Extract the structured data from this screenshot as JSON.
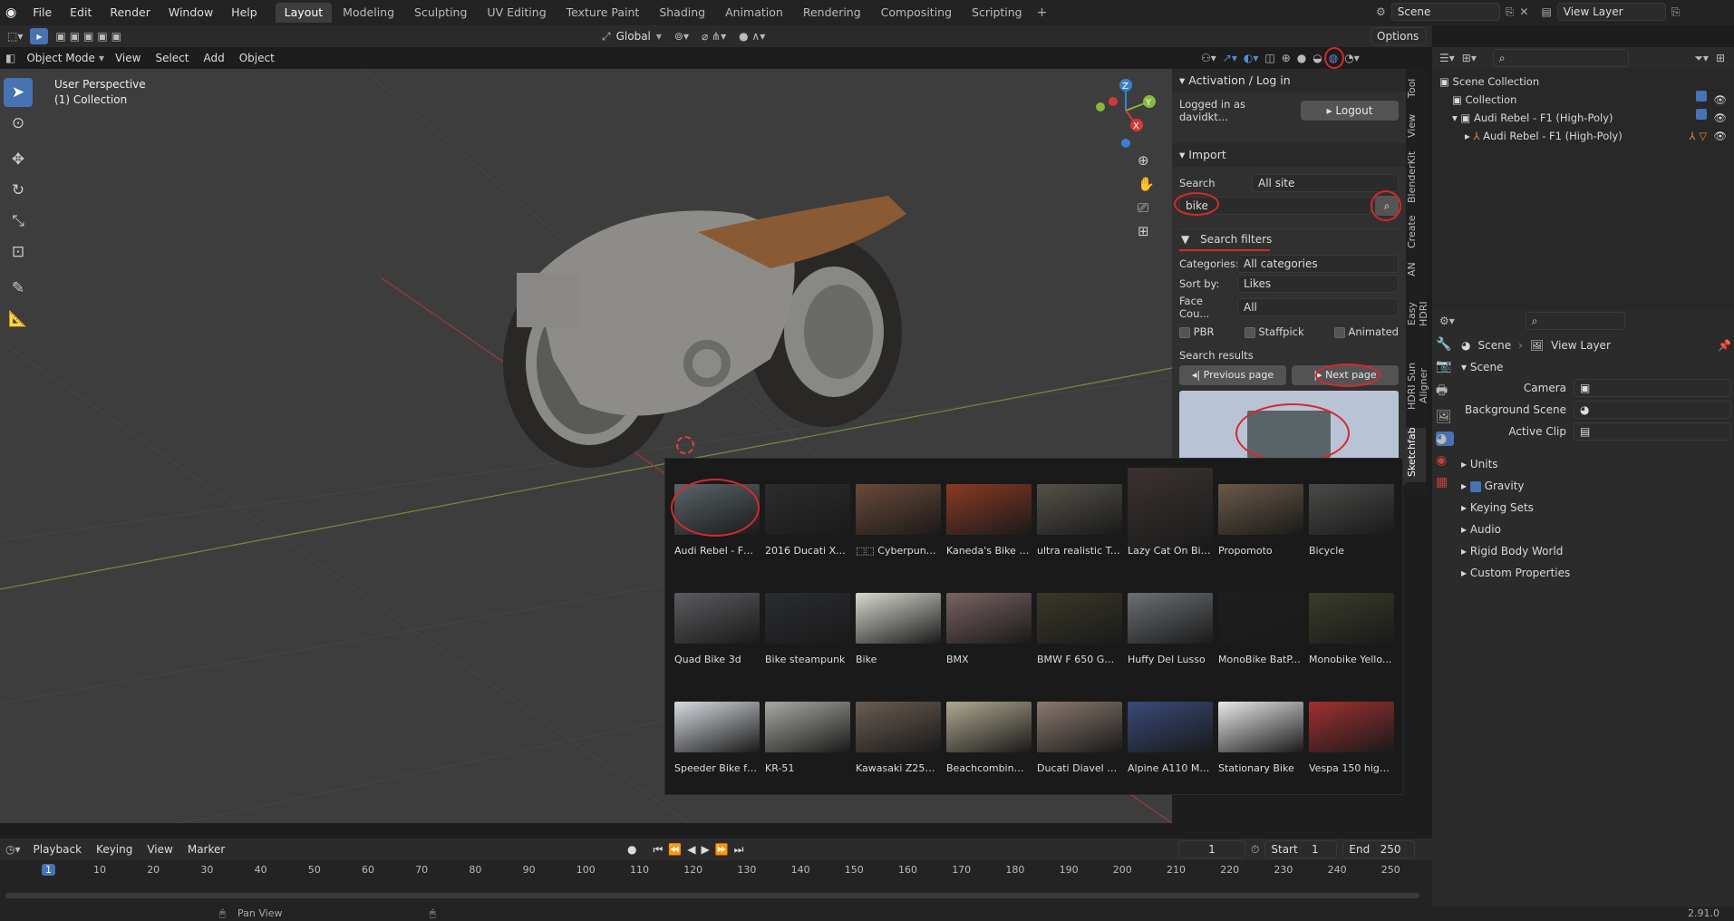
{
  "topbar": {
    "menus": [
      "File",
      "Edit",
      "Render",
      "Window",
      "Help"
    ],
    "workspaces": [
      "Layout",
      "Modeling",
      "Sculpting",
      "UV Editing",
      "Texture Paint",
      "Shading",
      "Animation",
      "Rendering",
      "Compositing",
      "Scripting"
    ],
    "active_workspace": "Layout",
    "scene_name": "Scene",
    "view_layer": "View Layer"
  },
  "tool_header": {
    "orientation": "Global",
    "options_label": "Options"
  },
  "viewport_header": {
    "mode": "Object Mode",
    "menus": [
      "View",
      "Select",
      "Add",
      "Object"
    ]
  },
  "viewport": {
    "perspective_label": "User Perspective",
    "collection_label": "(1) Collection"
  },
  "npanel": {
    "activation_title": "Activation / Log in",
    "logged_in_text": "Logged in as davidkt...",
    "logout_label": "Logout",
    "import_title": "Import",
    "search_label": "Search",
    "search_scope": "All site",
    "search_query": "bike",
    "search_filters_label": "Search filters",
    "categories_label": "Categories:",
    "categories_value": "All categories",
    "sort_label": "Sort by:",
    "sort_value": "Likes",
    "face_label": "Face Cou...",
    "face_value": "All",
    "pbr_label": "PBR",
    "staffpick_label": "Staffpick",
    "animated_label": "Animated",
    "results_label": "Search results",
    "prev_page_label": "Previous page",
    "next_page_label": "Next page"
  },
  "vertical_tabs": [
    "Tool",
    "View",
    "BlenderKit",
    "Create",
    "AN",
    "Easy HDRI",
    "HDRI Sun Aligner",
    "Sketchfab"
  ],
  "results": [
    {
      "label": "Audi Rebel - F1 ...",
      "color": "#5a6468"
    },
    {
      "label": "2016 Ducati X...",
      "color": "#2c2c2c"
    },
    {
      "label": "⬚⬚ Cyberpunk B...",
      "color": "#6a4a38"
    },
    {
      "label": "Kaneda's Bike (...",
      "color": "#8a3a22"
    },
    {
      "label": "ultra realistic Tr...",
      "color": "#55524a"
    },
    {
      "label": "Lazy Cat On Bike",
      "color": "#3a3230"
    },
    {
      "label": "Propomoto",
      "color": "#6a5a48"
    },
    {
      "label": "Bicycle",
      "color": "#4a4a48"
    },
    {
      "label": "Quad Bike 3d",
      "color": "#5c5c60"
    },
    {
      "label": "Bike steampunk",
      "color": "#2a2c30"
    },
    {
      "label": "Bike",
      "color": "#d8d8d0"
    },
    {
      "label": "BMX",
      "color": "#7a6262"
    },
    {
      "label": "BMW F 650 GS ...",
      "color": "#3a3828"
    },
    {
      "label": "Huffy Del Lusso",
      "color": "#6c7074"
    },
    {
      "label": "MonoBike BatP...",
      "color": "#1e1e1e"
    },
    {
      "label": "Monobike Yello...",
      "color": "#3a3c2a"
    },
    {
      "label": "Speeder Bike fr...",
      "color": "#d6dae0"
    },
    {
      "label": "KR-51",
      "color": "#a8a8a2"
    },
    {
      "label": "Kawasaki Z250...",
      "color": "#6a5c52"
    },
    {
      "label": "Beachcombing ...",
      "color": "#b0a890"
    },
    {
      "label": "Ducati Diavel M...",
      "color": "#8a7a70"
    },
    {
      "label": "Alpine A110 Mo...",
      "color": "#3a4a7a"
    },
    {
      "label": "Stationary Bike",
      "color": "#e8e8e8"
    },
    {
      "label": "Vespa 150 high...",
      "color": "#a03030"
    }
  ],
  "outliner": {
    "root": "Scene Collection",
    "collection": "Collection",
    "object": "Audi Rebel - F1 (High-Poly)",
    "child": "Audi Rebel - F1 (High-Poly)"
  },
  "properties": {
    "breadcrumb_scene": "Scene",
    "breadcrumb_layer": "View Layer",
    "section_scene": "Scene",
    "camera_label": "Camera",
    "bg_scene_label": "Background Scene",
    "active_clip_label": "Active Clip",
    "panels": [
      "Units",
      "Gravity",
      "Keying Sets",
      "Audio",
      "Rigid Body World",
      "Custom Properties"
    ]
  },
  "timeline": {
    "menus": [
      "Playback",
      "Keying",
      "View",
      "Marker"
    ],
    "current_frame": "1",
    "start_label": "Start",
    "start_value": "1",
    "end_label": "End",
    "end_value": "250",
    "ticks": [
      "1",
      "10",
      "20",
      "30",
      "40",
      "50",
      "60",
      "70",
      "80",
      "90",
      "100",
      "110",
      "120",
      "130",
      "140",
      "150",
      "160",
      "170",
      "180",
      "190",
      "200",
      "210",
      "220",
      "230",
      "240",
      "250"
    ]
  },
  "status": {
    "hint": "Pan View",
    "version": "2.91.0"
  },
  "colors": {
    "accent": "#4772b3",
    "annotation": "#d9262e",
    "x_axis": "#d03a3a",
    "y_axis": "#8ab83c",
    "z_axis": "#3b7fd4"
  }
}
